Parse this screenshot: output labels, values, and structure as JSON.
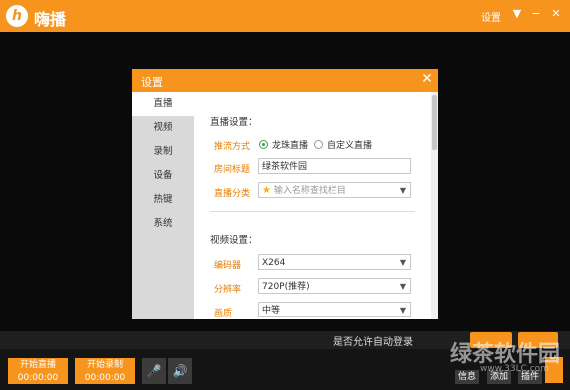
{
  "app": {
    "title": "嗨播",
    "logo_char": "h",
    "settings_label": "设置",
    "menu_icon": "▼",
    "minimize_icon": "−",
    "close_icon": "✕"
  },
  "dialog": {
    "title": "设置",
    "close_icon": "✕",
    "sidebar": [
      {
        "label": "直播",
        "active": true
      },
      {
        "label": "视频",
        "active": false
      },
      {
        "label": "录制",
        "active": false
      },
      {
        "label": "设备",
        "active": false
      },
      {
        "label": "热键",
        "active": false
      },
      {
        "label": "系统",
        "active": false
      }
    ],
    "live_settings": {
      "heading": "直播设置：",
      "push_method": {
        "label": "推流方式",
        "options": [
          "龙珠直播",
          "自定义直播"
        ],
        "selected": "龙珠直播"
      },
      "room_title": {
        "label": "房间标题",
        "value": "绿茶软件园"
      },
      "category": {
        "label": "直播分类",
        "placeholder": "输入名称查找栏目"
      }
    },
    "video_settings": {
      "heading": "视频设置：",
      "encoder": {
        "label": "编码器",
        "value": "X264"
      },
      "resolution": {
        "label": "分辨率",
        "value": "720P(推荐)"
      },
      "quality": {
        "label": "画质",
        "value": "中等"
      }
    }
  },
  "bottom": {
    "auto_login_text": "是否允许自动登录",
    "start_live": {
      "label": "开始直播",
      "time": "00:00:00"
    },
    "start_record": {
      "label": "开始录制",
      "time": "00:00:00"
    },
    "mic_icon": "🎤",
    "speaker_icon": "🔊",
    "buttons": [
      "信息",
      "添加",
      "插件"
    ]
  },
  "watermark": {
    "main": "绿茶软件园",
    "url": "www.33LC.com"
  },
  "colors": {
    "accent": "#f7941d",
    "background": "#000000",
    "radio_on": "#3aa14a",
    "label": "#e67e00"
  }
}
